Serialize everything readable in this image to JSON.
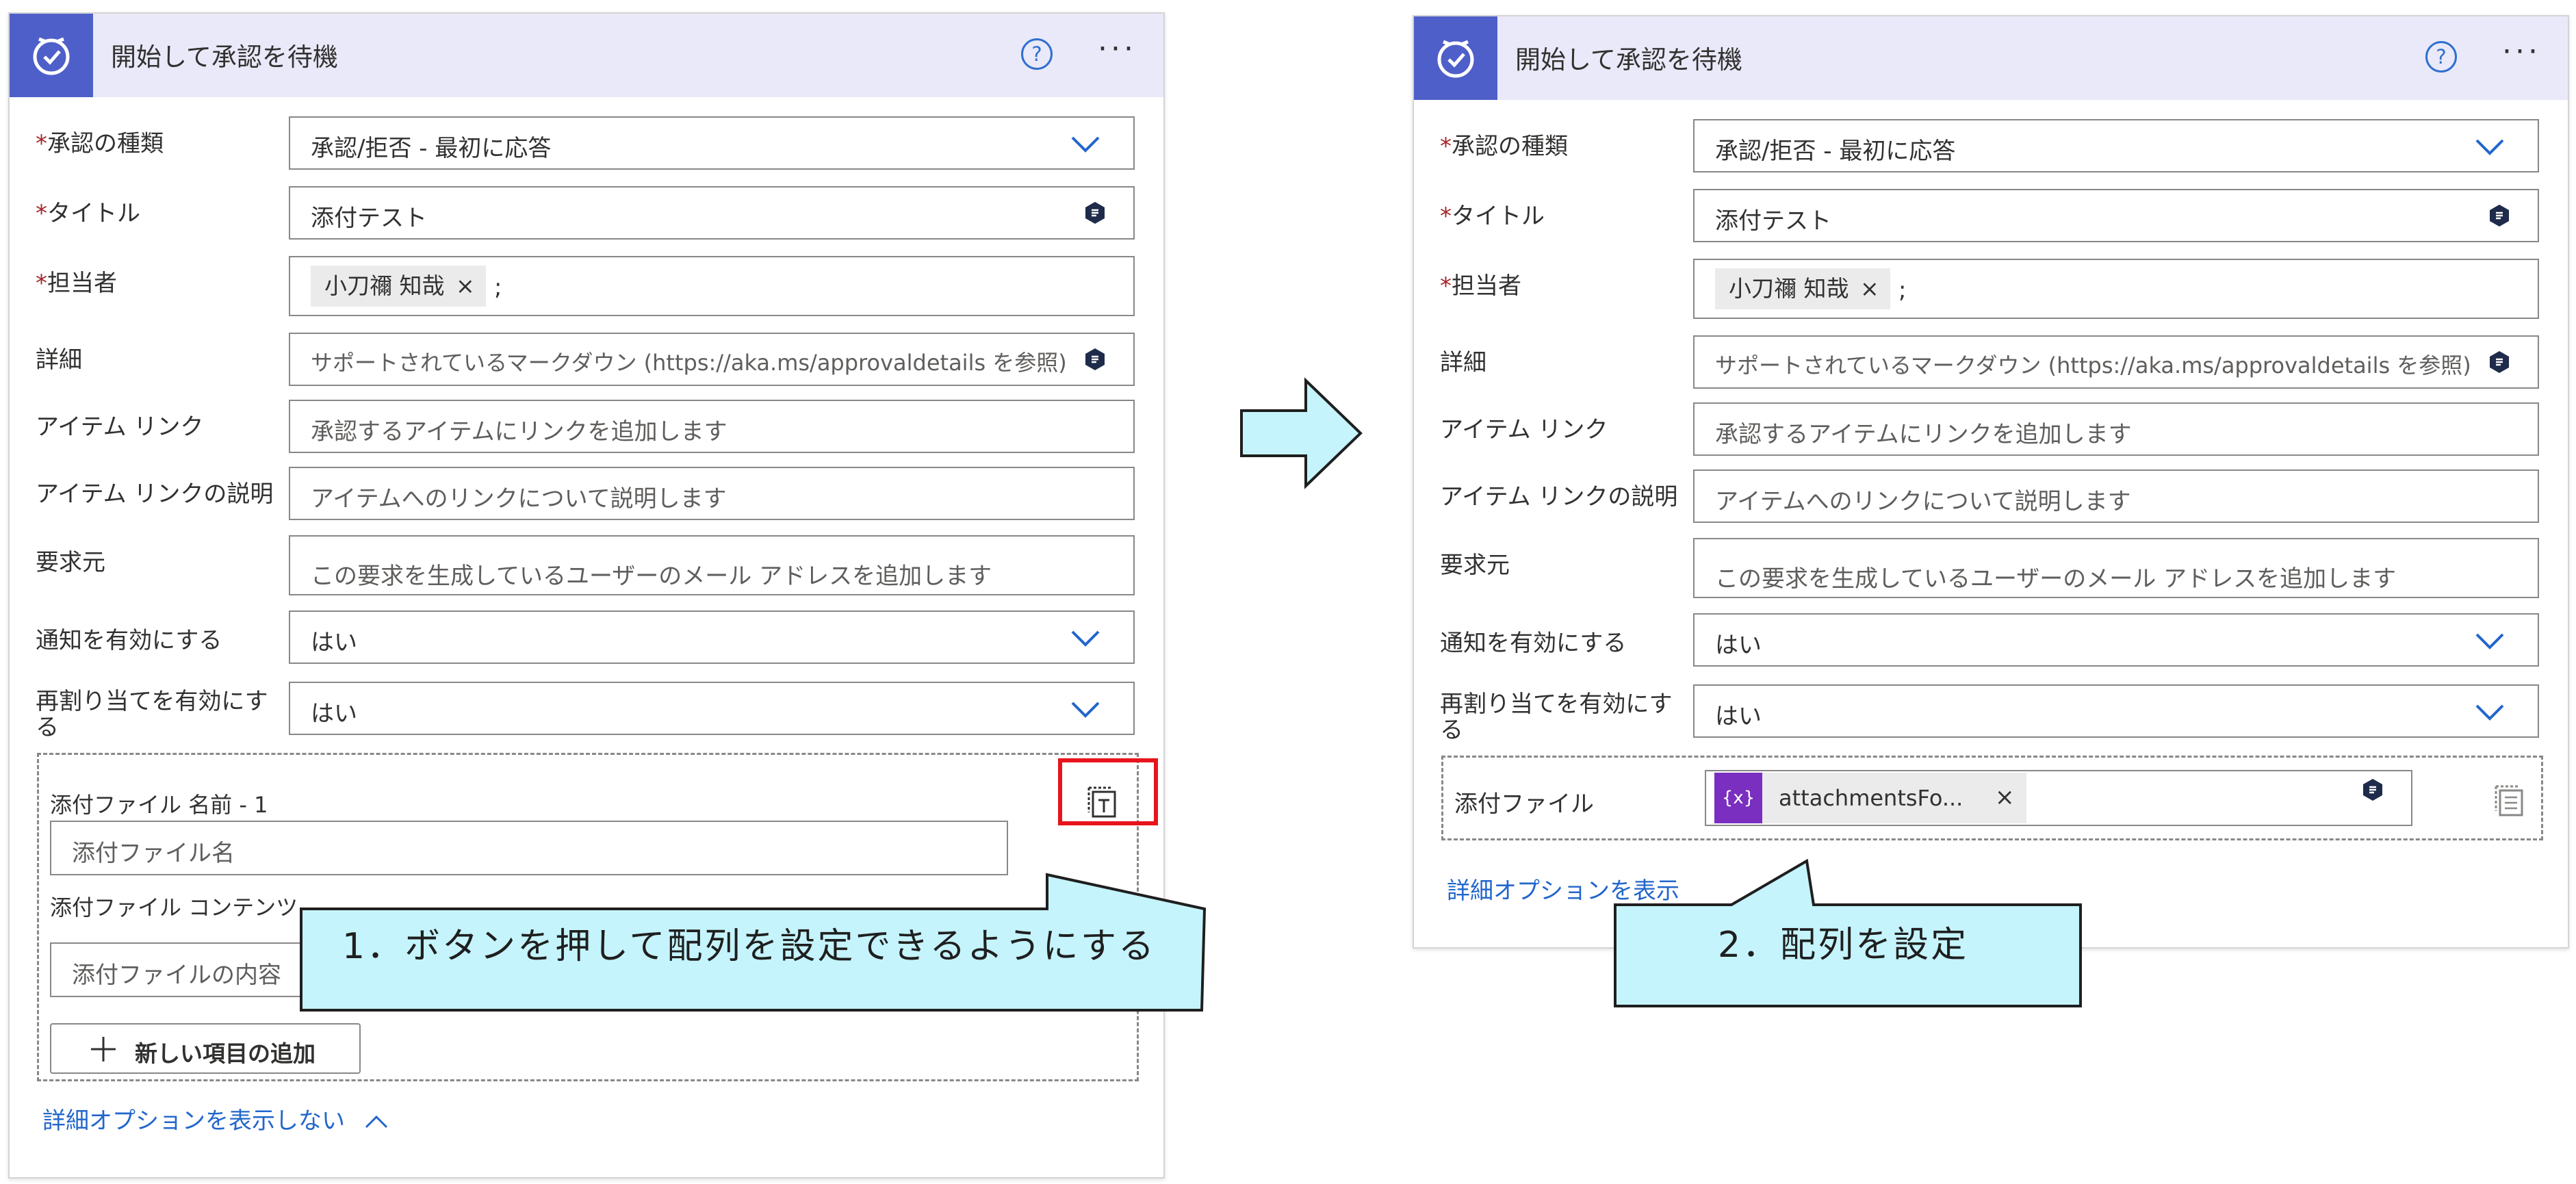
{
  "left_card": {
    "title": "開始して承認を待機",
    "help_glyph": "?",
    "more_glyph": "···",
    "fields": {
      "approval_type": {
        "label": "承認の種類",
        "value": "承認/拒否 - 最初に応答"
      },
      "title": {
        "label": "タイトル",
        "value": "添付テスト"
      },
      "assignee": {
        "label": "担当者",
        "tag": "小刀禰 知哉",
        "tag_close": "×",
        "separator": ";"
      },
      "details": {
        "label": "詳細",
        "placeholder": "サポートされているマークダウン (https://aka.ms/approvaldetails を参照)"
      },
      "item_link": {
        "label": "アイテム リンク",
        "placeholder": "承認するアイテムにリンクを追加します"
      },
      "item_link_desc": {
        "label": "アイテム リンクの説明",
        "placeholder": "アイテムへのリンクについて説明します"
      },
      "requestor": {
        "label": "要求元",
        "placeholder": "この要求を生成しているユーザーのメール アドレスを追加します"
      },
      "notifications": {
        "label": "通知を有効にする",
        "value": "はい"
      },
      "reassign": {
        "label": "再割り当てを有効にする",
        "value": "はい"
      }
    },
    "attachments": {
      "name_label": "添付ファイル 名前 - 1",
      "name_placeholder": "添付ファイル名",
      "content_label": "添付ファイル コンテンツ - 1",
      "content_placeholder": "添付ファイルの内容",
      "add_item": "新しい項目の追加"
    },
    "hide_advanced": "詳細オプションを表示しない"
  },
  "right_card": {
    "title": "開始して承認を待機",
    "help_glyph": "?",
    "more_glyph": "···",
    "fields": {
      "approval_type": {
        "label": "承認の種類",
        "value": "承認/拒否 - 最初に応答"
      },
      "title": {
        "label": "タイトル",
        "value": "添付テスト"
      },
      "assignee": {
        "label": "担当者",
        "tag": "小刀禰 知哉",
        "tag_close": "×",
        "separator": ";"
      },
      "details": {
        "label": "詳細",
        "placeholder": "サポートされているマークダウン (https://aka.ms/approvaldetails を参照)"
      },
      "item_link": {
        "label": "アイテム リンク",
        "placeholder": "承認するアイテムにリンクを追加します"
      },
      "item_link_desc": {
        "label": "アイテム リンクの説明",
        "placeholder": "アイテムへのリンクについて説明します"
      },
      "requestor": {
        "label": "要求元",
        "placeholder": "この要求を生成しているユーザーのメール アドレスを追加します"
      },
      "notifications": {
        "label": "通知を有効にする",
        "value": "はい"
      },
      "reassign": {
        "label": "再割り当てを有効にする",
        "value": "はい"
      }
    },
    "attachments": {
      "label": "添付ファイル",
      "token_icon": "{x}",
      "token_text": "attachmentsFo...",
      "token_close": "×"
    },
    "show_advanced": "詳細オプションを表示"
  },
  "callouts": {
    "step1": "1．ボタンを押して配列を設定できるようにする",
    "step2": "2．配列を設定"
  },
  "colors": {
    "header_bg": "#e9e9f9",
    "icon_bg": "#4f5fc9",
    "required_star": "#a4262c",
    "link": "#2266cc",
    "callout_fill": "#c5f4fc",
    "highlight": "#e8141c",
    "token": "#7a2fc0"
  },
  "icons": {
    "header": "approval-clock-icon",
    "dropdown": "chevron-down-icon",
    "dynamic_content": "dynamic-content-icon",
    "array_switch": "switch-to-array-icon",
    "add": "plus-icon",
    "collapse": "chevron-up-icon",
    "arrow": "right-arrow-icon"
  }
}
